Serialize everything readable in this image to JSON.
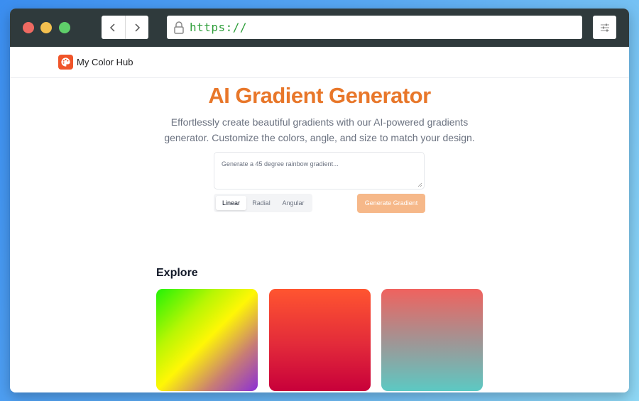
{
  "browser": {
    "url": "https://",
    "icons": {
      "back": "chevron-left-icon",
      "forward": "chevron-right-icon",
      "lock": "lock-icon",
      "menu": "sliders-icon"
    }
  },
  "site": {
    "brand": "My Color Hub",
    "logo_icon": "palette-icon",
    "accent_color": "#e8772a"
  },
  "hero": {
    "title": "AI Gradient Generator",
    "subtitle": "Effortlessly create beautiful gradients with our AI-powered gradients generator. Customize the colors, angle, and size to match your design."
  },
  "prompt": {
    "placeholder": "Generate a 45 degree rainbow gradient..."
  },
  "gradient_types": {
    "options": [
      "Linear",
      "Radial",
      "Angular"
    ],
    "selected": "Linear"
  },
  "generate_button": {
    "label": "Generate Gradient",
    "color": "#f6b889"
  },
  "explore": {
    "heading": "Explore",
    "cards": [
      {
        "colors": [
          "#22f206",
          "#fff705",
          "#8b2fd6"
        ]
      },
      {
        "colors": [
          "#ff5530",
          "#c8003a"
        ]
      },
      {
        "colors": [
          "#f0625e",
          "#5cc9c3"
        ]
      }
    ]
  }
}
